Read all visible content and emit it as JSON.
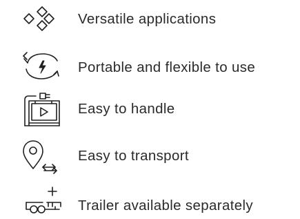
{
  "features": [
    {
      "icon": "diamonds-icon",
      "label": "Versatile applications"
    },
    {
      "icon": "cycle-power-icon",
      "label": "Portable and flexible to use"
    },
    {
      "icon": "battery-unit-icon",
      "label": "Easy to handle"
    },
    {
      "icon": "location-transport-icon",
      "label": "Easy to transport"
    },
    {
      "icon": "trailer-icon",
      "label": "Trailer available separately"
    }
  ],
  "colors": {
    "text": "#2a2a2a",
    "icon": "#1f1f1f",
    "background": "#ffffff"
  }
}
